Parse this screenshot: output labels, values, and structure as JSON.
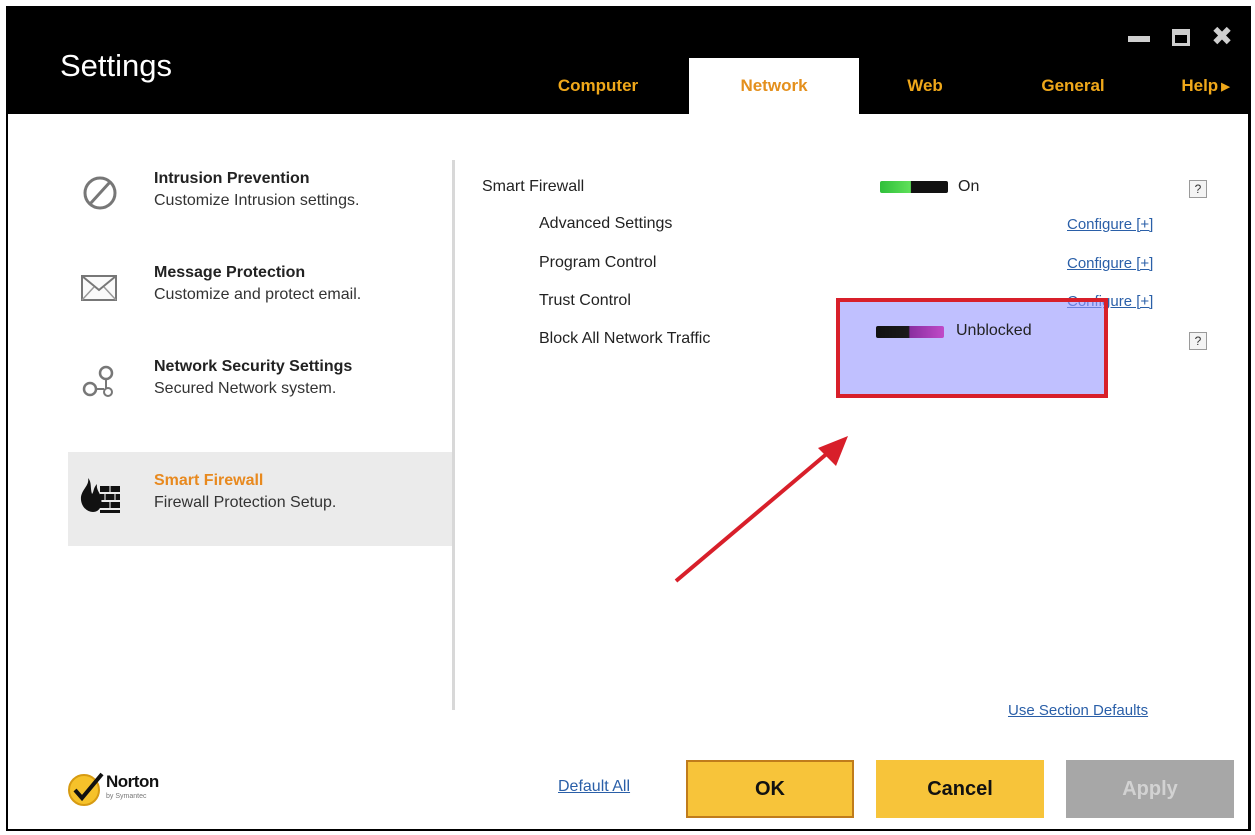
{
  "window": {
    "title": "Settings",
    "controls": {
      "minimize": "minimize-icon",
      "maximize": "maximize-icon",
      "close": "close-icon"
    }
  },
  "tabs": [
    {
      "label": "Computer",
      "active": false
    },
    {
      "label": "Network",
      "active": true
    },
    {
      "label": "Web",
      "active": false
    },
    {
      "label": "General",
      "active": false
    },
    {
      "label": "Help",
      "active": false
    }
  ],
  "sidebar": {
    "items": [
      {
        "title": "Intrusion Prevention",
        "desc": "Customize Intrusion settings.",
        "icon": "prohibited-icon"
      },
      {
        "title": "Message Protection",
        "desc": "Customize and protect email.",
        "icon": "envelope-icon"
      },
      {
        "title": "Network Security Settings",
        "desc": "Secured Network system.",
        "icon": "network-nodes-icon"
      },
      {
        "title": "Smart Firewall",
        "desc": "Firewall Protection Setup.",
        "icon": "firewall-flame-icon",
        "active": true
      }
    ]
  },
  "main": {
    "smart_firewall": {
      "label": "Smart Firewall",
      "toggle_state": "On",
      "help": "?"
    },
    "advanced_settings": {
      "label": "Advanced Settings",
      "link": "Configure [+]"
    },
    "program_control": {
      "label": "Program Control",
      "link": "Configure [+]"
    },
    "trust_control": {
      "label": "Trust Control",
      "link": "Configure [+]"
    },
    "block_all": {
      "label": "Block All Network Traffic",
      "toggle_state": "Unblocked",
      "help": "?"
    },
    "use_section_defaults": "Use Section Defaults"
  },
  "footer": {
    "logo_brand": "Norton",
    "logo_sub": "by Symantec",
    "default_all": "Default All",
    "ok": "OK",
    "cancel": "Cancel",
    "apply": "Apply"
  },
  "colors": {
    "accent_orange": "#f0a81a",
    "button_yellow": "#f7c43a",
    "link_blue": "#2a5fa8",
    "highlight_red": "#d81f2a",
    "highlight_fill": "#9696ff"
  }
}
